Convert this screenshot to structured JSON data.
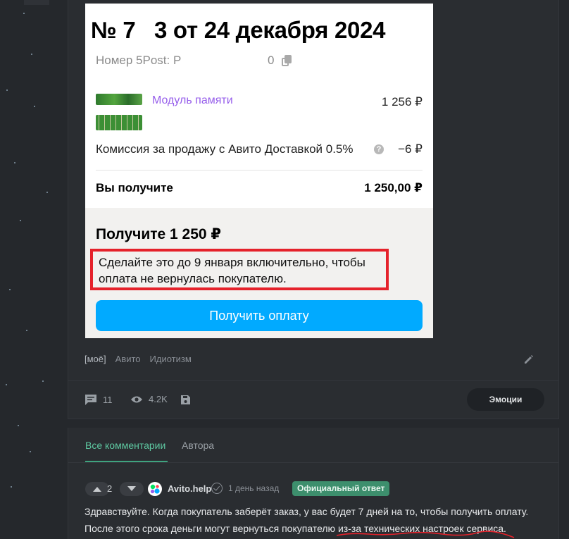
{
  "receipt": {
    "title": "№ 7   3 от 24 декабря 2024",
    "post_label": "Номер 5Post: Р",
    "post_value": "0",
    "item_name": "Модуль памяти",
    "item_price": "1 256 ₽",
    "fee_label": "Комиссия за продажу с Авито Доставкой 0.5%",
    "fee_help": "?",
    "fee_value": "−6 ₽",
    "you_get_label": "Вы получите",
    "you_get_value": "1 250,00 ₽",
    "receive_title": "Получите 1 250 ₽",
    "deadline_text": "Сделайте это до 9 января включительно, чтобы оплата не вернулась покупателю.",
    "pay_button": "Получить оплату",
    "highlight_color": "#e5222b",
    "button_color": "#01aaff"
  },
  "post": {
    "tags": [
      "[моё]",
      "Авито",
      "Идиотизм"
    ],
    "comments_count": "11",
    "views_count": "4.2K",
    "emotions_button": "Эмоции"
  },
  "comments": {
    "tabs": [
      "Все комментарии",
      "Автора"
    ],
    "active_tab": "Все комментарии",
    "first": {
      "votes": "2",
      "author": "Avito.help",
      "time": "1 день назад",
      "badge": "Официальный ответ",
      "text": "Здравствуйте. Когда покупатель заберёт заказ, у вас будет 7 дней на то, чтобы получить оплату. После этого срока деньги могут вернуться покупателю из-за технических настроек сервиса."
    }
  },
  "icons": [
    "copy-icon",
    "help-icon",
    "edit-icon",
    "comment-icon",
    "eye-icon",
    "save-icon",
    "upvote-icon",
    "downvote-icon",
    "verified-icon"
  ]
}
